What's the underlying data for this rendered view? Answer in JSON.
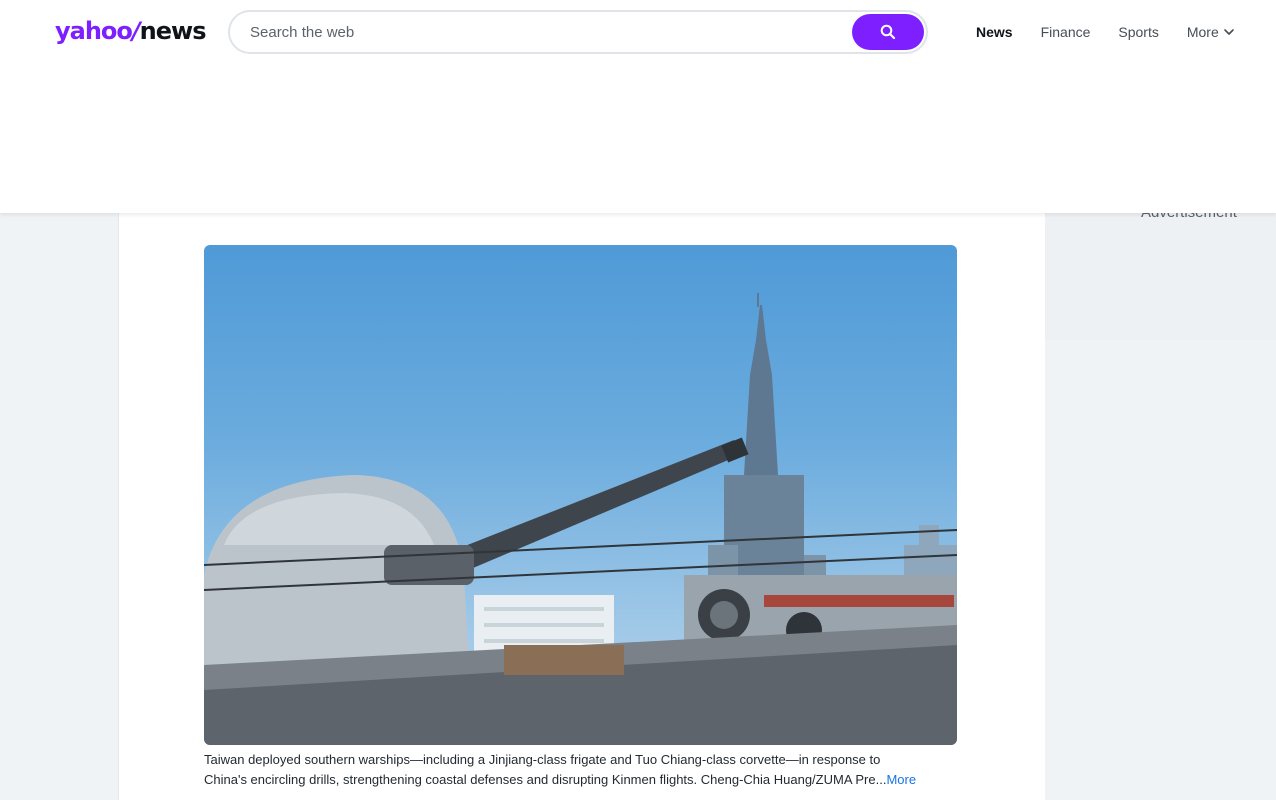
{
  "header": {
    "logo": {
      "part1": "yahoo",
      "slash": "/",
      "part2": "news"
    },
    "search": {
      "placeholder": "Search the web",
      "button_icon": "search-icon"
    },
    "nav": [
      {
        "label": "News",
        "active": true
      },
      {
        "label": "Finance",
        "active": false
      },
      {
        "label": "Sports",
        "active": false
      },
      {
        "label": "More",
        "active": false,
        "icon": "chevron-down-icon"
      }
    ]
  },
  "article": {
    "image_description_icon": "warship-gun-photo",
    "caption_line1": "Taiwan deployed southern warships—including a Jinjiang-class frigate and Tuo Chiang-class corvette—in response to",
    "caption_line2": "China's encircling drills, strengthening coastal defenses and disrupting Kinmen flights. Cheng-Chia Huang/ZUMA Pre",
    "more_ellipsis": "...",
    "more_label": "More"
  },
  "right_rail": {
    "ad_label": "Advertisement"
  },
  "colors": {
    "brand_purple": "#7e1fff",
    "link_blue": "#1a73e8",
    "page_bg": "#f0f3f5"
  }
}
